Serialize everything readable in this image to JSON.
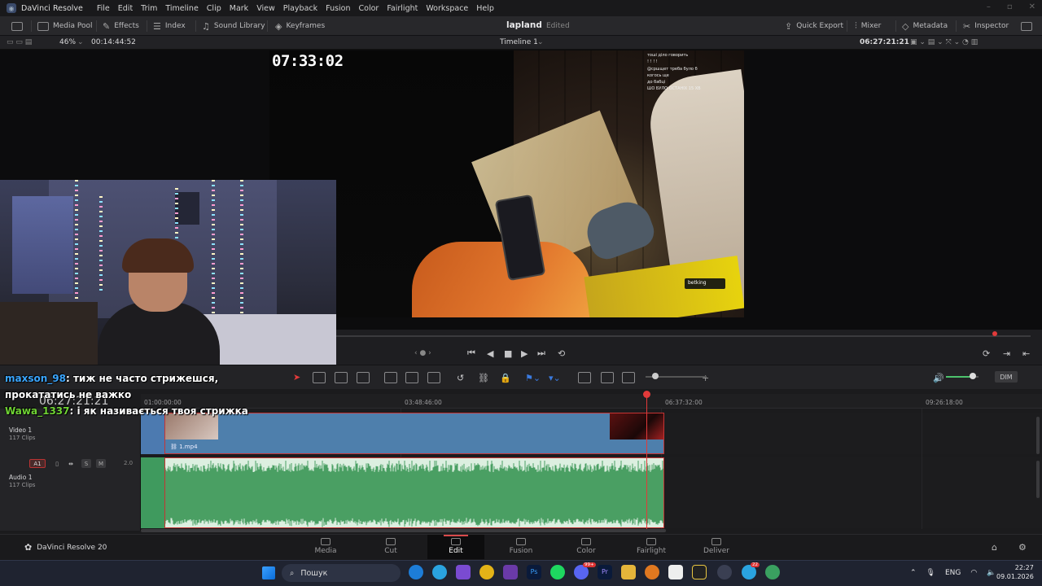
{
  "titlebar": {
    "app_title": "DaVinci Resolve",
    "menu": [
      "File",
      "Edit",
      "Trim",
      "Timeline",
      "Clip",
      "Mark",
      "View",
      "Playback",
      "Fusion",
      "Color",
      "Fairlight",
      "Workspace",
      "Help"
    ]
  },
  "toolbar": {
    "media_pool": "Media Pool",
    "effects": "Effects",
    "index": "Index",
    "sound_library": "Sound Library",
    "keyframes": "Keyframes",
    "project_name": "lapland",
    "project_status": "Edited",
    "quick_export": "Quick Export",
    "mixer": "Mixer",
    "metadata": "Metadata",
    "inspector": "Inspector"
  },
  "viewer_header": {
    "zoom": "46%",
    "source_timecode": "00:14:44:52",
    "timeline_name": "Timeline 1",
    "record_timecode": "06:27:21:21"
  },
  "video_overlay": {
    "timer": "07:33:02",
    "chat_lines": [
      "тоші діло говорить",
      "! ! ! !",
      "@сршщет треба було б",
      "когось ще",
      "до бабці",
      "ШО БУЛО ОСТАНІХ 15 ХВ"
    ],
    "tag": "betking"
  },
  "stream_chat": {
    "line1_user": "maxson_98",
    "line1_text": ": тиж не часто стрижешся,",
    "line2_text": "прокататись не важко",
    "line3_user": "Wawa_1337",
    "line3_text": ": і як називається твоя стрижка",
    "overlay_timecode": "06:27:21:21"
  },
  "edit_toolbar": {
    "dim_label": "DIM"
  },
  "timeline": {
    "ruler_ticks": [
      "01:00:00:00",
      "03:48:46:00",
      "06:37:32:00",
      "09:26:18:00"
    ],
    "video_track": {
      "name": "Video 1",
      "clips": "117 Clips",
      "clip_name": "1.mp4"
    },
    "audio_track": {
      "badge": "A1",
      "name": "Audio 1",
      "clips": "117 Clips",
      "volume": "2.0",
      "solo": "S",
      "mute": "M"
    }
  },
  "pages": [
    "Media",
    "Cut",
    "Edit",
    "Fusion",
    "Color",
    "Fairlight",
    "Deliver"
  ],
  "active_page": "Edit",
  "brand": "DaVinci Resolve 20",
  "taskbar": {
    "search_placeholder": "Пошук",
    "lang": "ENG",
    "time": "22:27",
    "date": "09.01.2026",
    "badge_discord": "99+",
    "badge_telegram": "22"
  },
  "colors": {
    "accent_red": "#e23a3a",
    "video_clip": "#4e7fac",
    "audio_clip_bg": "#dcefe0",
    "audio_wave": "#4a9f63"
  }
}
